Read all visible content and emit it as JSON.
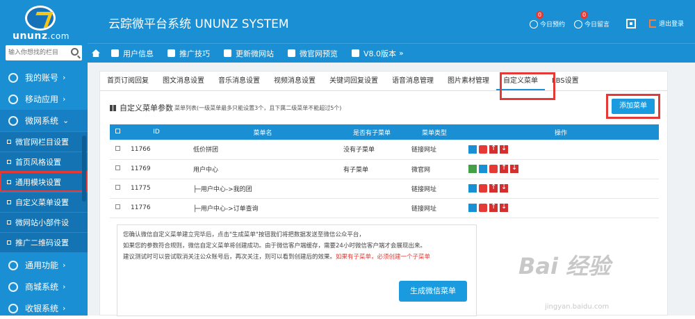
{
  "brand": {
    "logo_text": "ununz",
    "logo_suffix": ".com"
  },
  "search": {
    "placeholder": "输入你想找的栏目"
  },
  "header": {
    "title": "云踪微平台系统 UNUNZ SYSTEM",
    "appointments_label": "今日预约",
    "appointments_count": "0",
    "messages_label": "今日留言",
    "messages_count": "0",
    "logout_label": "退出登录"
  },
  "toolbar": {
    "items": [
      "用户信息",
      "推广技巧",
      "更新微网站",
      "微官网预览",
      "V8.0版本"
    ],
    "more": "»"
  },
  "sidebar": {
    "items": [
      {
        "label": "我的账号",
        "arrow": "›"
      },
      {
        "label": "移动应用",
        "arrow": "›"
      },
      {
        "label": "微网系统",
        "arrow": "⌄"
      }
    ],
    "sub_items": [
      "微官网栏目设置",
      "首页风格设置",
      "通用模块设置",
      "自定义菜单设置",
      "微网站小部件设",
      "推广二维码设置"
    ],
    "bottom_items": [
      {
        "label": "通用功能",
        "arrow": "›"
      },
      {
        "label": "商城系统",
        "arrow": "›"
      },
      {
        "label": "收银系统",
        "arrow": "›"
      }
    ]
  },
  "tabs": [
    "首页订阅回复",
    "图文消息设置",
    "音乐消息设置",
    "视频消息设置",
    "关键词回复设置",
    "语音消息管理",
    "图片素材管理",
    "自定义菜单",
    "LBS设置"
  ],
  "section": {
    "title": "自定义菜单参数",
    "subtitle": "菜单列表(一级菜单最多只能设置3个，且下属二级菜单不能超过5个)",
    "add_button": "添加菜单"
  },
  "table": {
    "headers": [
      "ID",
      "菜单名",
      "是否有子菜单",
      "菜单类型",
      "操作"
    ],
    "rows": [
      {
        "id": "11766",
        "name": "低价拼团",
        "has_sub": "没有子菜单",
        "type": "链接网址"
      },
      {
        "id": "11769",
        "name": "用户中心",
        "has_sub": "有子菜单",
        "type": "微官网"
      },
      {
        "id": "11775",
        "name": "├─用户中心->我的团",
        "has_sub": "",
        "type": "链接网址"
      },
      {
        "id": "11776",
        "name": "├─用户中心->订单查询",
        "has_sub": "",
        "type": "链接网址"
      }
    ]
  },
  "notice": {
    "line1": "您确认微信自定义菜单建立完毕后，点击\"生成菜单\"按钮我们将把数据发送至微信公众平台，",
    "line2": "如果您的参数符合规则，微信自定义菜单将创建成功。由于微信客户端缓存，需要24小时微信客户端才会展现出来。",
    "line3": "建议测试时可以尝试取消关注公众账号后，再次关注，则可以看到创建后的效果。",
    "line3_red": "如果有子菜单，必须创建一个子菜单"
  },
  "generate_button": "生成微信菜单",
  "watermark": {
    "text": "Bai 经验",
    "url": "jingyan.baidu.com"
  }
}
